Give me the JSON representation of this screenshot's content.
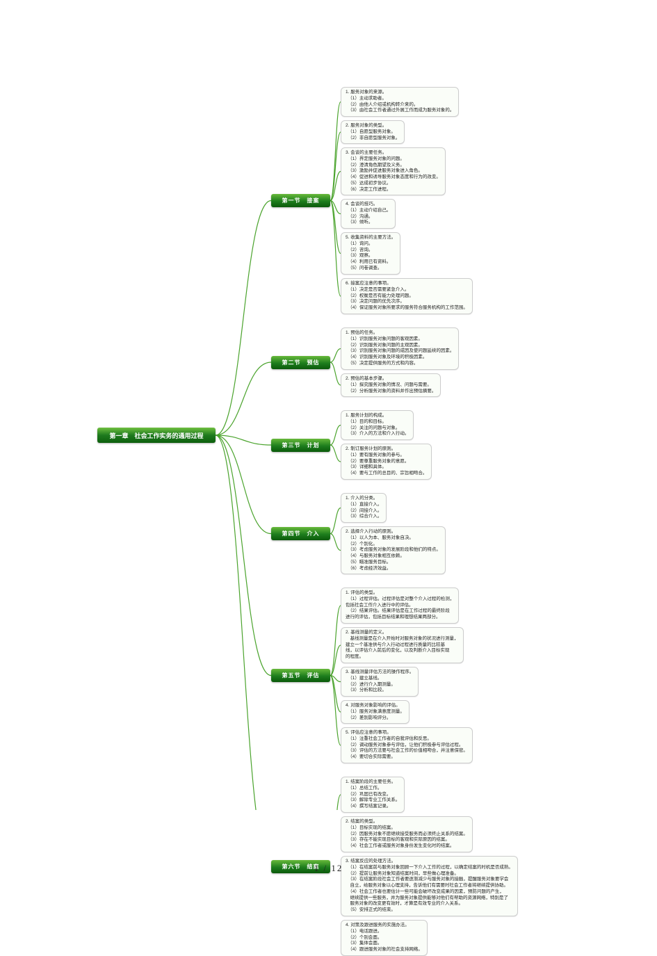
{
  "page": {
    "current": "1",
    "total": "12",
    "sep": " / "
  },
  "root": {
    "label": "第一章　社会工作实务的通用过程"
  },
  "sections": [
    {
      "id": "s1",
      "label": "第一节　接案",
      "topPx": 160
    },
    {
      "id": "s2",
      "label": "第二节　预估",
      "topPx": 345
    },
    {
      "id": "s3",
      "label": "第三节　计划",
      "topPx": 455
    },
    {
      "id": "s4",
      "label": "第四节　介入",
      "topPx": 555
    },
    {
      "id": "s5",
      "label": "第五节　评估",
      "topPx": 700
    },
    {
      "id": "s6",
      "label": "第六节　结案",
      "topPx": 900
    }
  ],
  "bubbles": [
    {
      "section": "s1",
      "title": "1. 服务对象的来源。",
      "items": [
        "（1）主动求助者。",
        "（2）由他人介绍或机构转介来的。",
        "（3）由社会工作者通过外展工作而成为服务对象的。"
      ]
    },
    {
      "section": "s1",
      "title": "2. 服务对象的类型。",
      "items": [
        "（1）自愿型服务对象。",
        "（2）非自愿型服务对象。"
      ]
    },
    {
      "section": "s1",
      "title": "3. 会谈的主要任务。",
      "items": [
        "（1）界定服务对象的问题。",
        "（2）澄清角色期望及义务。",
        "（3）激励并促进服务对象进入角色。",
        "（4）促进和诱导服务对象态度和行为的改变。",
        "（5）达成初步协议。",
        "（6）决定工作进程。"
      ]
    },
    {
      "section": "s1",
      "title": "4. 会谈的技巧。",
      "items": [
        "（1）主动介绍自己。",
        "（2）沟通。",
        "（3）倾听。"
      ]
    },
    {
      "section": "s1",
      "title": "5. 收集资料的主要方法。",
      "items": [
        "（1）询问。",
        "（2）咨询。",
        "（3）观察。",
        "（4）利用已有资料。",
        "（5）问卷调查。"
      ]
    },
    {
      "section": "s1",
      "title": "6. 接案应注意的事项。",
      "items": [
        "（1）决定是否需要紧急介入。",
        "（2）权衡是否有能力处理问题。",
        "（3）决定问题的优先次序。",
        "（4）保证服务对象所要求的服务符合服务机构的工作范围。"
      ]
    },
    {
      "section": "s2",
      "title": "1. 预估的任务。",
      "items": [
        "（1）识别服务对象问题的客观因素。",
        "（2）识别服务对象问题的主观因素。",
        "（3）识别服务对象问题的成因及使问题延续的因素。",
        "（4）识别服务对象及环境的积极因素。",
        "（5）决定提供服务的方式和内容。"
      ]
    },
    {
      "section": "s2",
      "title": "2. 预估的基本步骤。",
      "items": [
        "（1）探究服务对象的情况、问题与需要。",
        "（2）分析服务对象的资料并作出预估摘要。"
      ]
    },
    {
      "section": "s3",
      "title": "1. 服务计划的构成。",
      "items": [
        "（1）目的和目标。",
        "（2）关注的问题与对象。",
        "（3）介入的方法和介入行动。"
      ]
    },
    {
      "section": "s3",
      "title": "2. 制订服务计划的原则。",
      "items": [
        "（1）要有服务对象的参与。",
        "（2）要尊重服务对象的意愿。",
        "（3）详细和具体。",
        "（4）要与工作的总目的、宗旨相吻合。"
      ]
    },
    {
      "section": "s4",
      "title": "1. 介入的分类。",
      "items": [
        "（1）直接介入。",
        "（2）间接介入。",
        "（3）综合介入。"
      ]
    },
    {
      "section": "s4",
      "title": "2. 选择介入行动的原则。",
      "items": [
        "（1）以人为本、服务对象自决。",
        "（2）个别化。",
        "（3）考虑服务对象的发展阶段和他们的特点。",
        "（4）与服务对象相互依赖。",
        "（5）瞄准服务目标。",
        "（6）考虑经济效益。"
      ]
    },
    {
      "section": "s5",
      "title": "1. 评估的类型。",
      "items": [
        "（1）过程评估。过程评估是对整个介入过程的检测，\n包括社会工作介入进行中的评估。",
        "（2）结果评估。结果评估是在工作过程的最终阶段\n进行的评估，包括目标结果和理想结果两部分。"
      ]
    },
    {
      "section": "s5",
      "title": "2. 基线测量的定义。",
      "items": [
        "基线测量是在介入开始时对服务对象的状况进行测量，\n建立一个基准供与介入行动过程进行质量的比较基\n线，以评估介入前后的变化，以及判断介入目标实现\n的程度。"
      ]
    },
    {
      "section": "s5",
      "title": "3. 基线测量评估方法的操作程序。",
      "items": [
        "（1）建立基线。",
        "（2）进行介入期测量。",
        "（3）分析和比较。"
      ]
    },
    {
      "section": "s5",
      "title": "4. 对服务对象影响的评估。",
      "items": [
        "（1）服务对象满意度测量。",
        "（2）差别影响评分。"
      ]
    },
    {
      "section": "s5",
      "title": "5. 评估应注意的事项。",
      "items": [
        "（1）注重社会工作者的自我评估和反思。",
        "（2）调动服务对象参与评估，让他们积极参与评估过程。",
        "（3）评估的方法要与社会工作的价值相吻合，并注意保密。",
        "（4）要切合实际需要。"
      ]
    },
    {
      "section": "s6",
      "title": "1. 结案阶段的主要任务。",
      "items": [
        "（1）总结工作。",
        "（2）巩固已有改变。",
        "（3）解除专业工作关系。",
        "（4）撰写结案记录。"
      ]
    },
    {
      "section": "s6",
      "title": "2. 结案的类型。",
      "items": [
        "（1）目标实现的结案。",
        "（2）因服务对象不愿继续接受服务而必须终止关系的结案。",
        "（3）存在不能实现目标的客观和实际原因的结案。",
        "（4）社会工作者或服务对象身份发生变化时的结案。"
      ]
    },
    {
      "section": "s6",
      "title": "3. 结案反应的处理方法。",
      "items": [
        "（1）在结案前与服务对象回顾一下介入工作的过程，以确定结案的时机是否成熟。",
        "（2）提前让服务对象知道结案时间，早些做心理准备。",
        "（3）在结案阶段社会工作者要逐渐减少与服务对象的接触，提醒服务对象要学会",
        "自立，给服务对象以心理支持，告诉他们有需要时社会工作者将继续提供协助。",
        "（4）社会工作者也要估计一些可能会破坏改变成果的因素，预防问题的产生，",
        "继续提供一些服务，并为服务对象提供能够对他们有帮助的资源网络，特别是了",
        "服务对象的改变更有效时，才算是有效专业的介入关系。",
        "（5）安排正式的结束。"
      ]
    },
    {
      "section": "s6",
      "title": "4. 对策及跟进服务的实施办法。",
      "items": [
        "（1）电话跟进。",
        "（2）个别会面。",
        "（3）集体会面。",
        "（4）跟进服务对象的社会支持网络。"
      ]
    }
  ]
}
